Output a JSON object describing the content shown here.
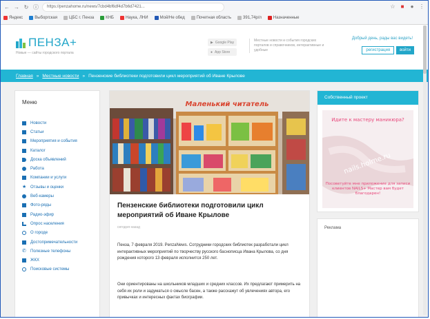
{
  "browser": {
    "url": "https://penzahome.ru/news/7cbd4bf6df4d7b6d7421...",
    "bookmarks": [
      "Яндекс",
      "Выборгская",
      "ЦБС г. Пенза",
      "КНБ",
      "Наука, ЛНИ",
      "Мой/Не обед",
      "Почетная область",
      "391,74р/л",
      "Назначенные"
    ]
  },
  "site": {
    "logo_text": "ПЕНЗА+",
    "logo_sub": "Новые — сайты городского портала",
    "hdr_btn_1": "Google Play",
    "hdr_btn_2": "App Store",
    "hdr_note": "Местные новости и события городских порталов и справочников, интерактивные и удобные",
    "greeting": "Добрый день, рады вас видеть!",
    "register": "регистрация",
    "login": "войти"
  },
  "breadcrumb": {
    "home": "Главная",
    "section": "Местные новости",
    "current": "Пензенские библиотеки подготовили цикл мероприятий об Иване Крылове",
    "separator": "»"
  },
  "menu": {
    "title": "Меню",
    "items": [
      {
        "label": "Новости",
        "icon": "news-icon"
      },
      {
        "label": "Статьи",
        "icon": "article-icon"
      },
      {
        "label": "Мероприятия и события",
        "icon": "calendar-icon"
      },
      {
        "label": "Каталог",
        "icon": "catalog-icon"
      },
      {
        "label": "Доска объявлений",
        "icon": "megaphone-icon"
      },
      {
        "label": "Работа",
        "icon": "briefcase-icon"
      },
      {
        "label": "Компании и услуги",
        "icon": "building-icon"
      },
      {
        "label": "Отзывы и оценки",
        "icon": "star-icon"
      },
      {
        "label": "Веб-камеры",
        "icon": "webcam-icon"
      },
      {
        "label": "Фото-ряды",
        "icon": "photo-icon"
      },
      {
        "label": "Радио-эфир",
        "icon": "radio-icon"
      },
      {
        "label": "Опрос населения",
        "icon": "chart-icon"
      },
      {
        "label": "О городе",
        "icon": "info-icon"
      },
      {
        "label": "Достопримечательности",
        "icon": "landmark-icon"
      },
      {
        "label": "Полезные телефоны",
        "icon": "phone-icon"
      },
      {
        "label": "ЖКХ",
        "icon": "house-icon"
      },
      {
        "label": "Поисковые системы",
        "icon": "clock-icon"
      }
    ]
  },
  "article": {
    "title": "Пензенские библиотеки подготовили цикл мероприятий об Иване Крылове",
    "meta": "сегодня назад",
    "p1": "Пенза, 7 февраля 2019. PenzaNews. Сотрудники городских библиотек разработали цикл интерактивных мероприятий по творчеству русского баснописца Ивана Крылова, со дня рождения которого 13 февраля исполнится 250 лет.",
    "p2": "Они ориентированы на школьников младших и средних классов. Их предлагают примерить на себя их роли и задуматься о смысле басен, а также расскажут об увлечениях автора, его привычках и интересных фактах биографии.",
    "photo_banner": "Маленький читатель"
  },
  "sidebar": {
    "project_title": "Собственный проект",
    "promo_top": "Идите к мастеру маникюра?",
    "promo_site": "nails.holme.ru",
    "promo_bottom": "Посоветуйте мне приложение для записи клиентов NAILS+ Мастер вам будет благодарен!",
    "ads_title": "Реклама"
  },
  "colors": {
    "accent": "#22b5d4",
    "link": "#1a6fb3",
    "pink": "#e8467a"
  }
}
